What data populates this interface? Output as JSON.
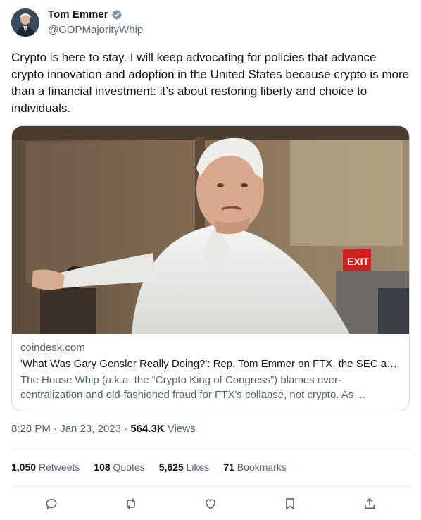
{
  "author": {
    "name": "Tom Emmer",
    "handle": "@GOPMajorityWhip",
    "verified_icon": "verified-badge-icon"
  },
  "tweet": {
    "text": "Crypto is here to stay. I will keep advocating for policies that advance crypto innovation and adoption in the United States because crypto is more than a financial investment: it’s about restoring liberty and choice to individuals."
  },
  "card": {
    "domain": "coindesk.com",
    "title": "'What Was Gary Gensler Really Doing?': Rep. Tom Emmer on FTX, the SEC and...",
    "description": "The House Whip (a.k.a. the “Crypto King of Congress”) blames over-centralization and old-fashioned fraud for FTX’s collapse, not crypto. As ..."
  },
  "meta": {
    "time": "8:28 PM",
    "separator1": "·",
    "date": "Jan 23, 2023",
    "separator2": "·",
    "views_count": "564.3K",
    "views_label": "Views"
  },
  "stats": {
    "retweets_count": "1,050",
    "retweets_label": "Retweets",
    "quotes_count": "108",
    "quotes_label": "Quotes",
    "likes_count": "5,625",
    "likes_label": "Likes",
    "bookmarks_count": "71",
    "bookmarks_label": "Bookmarks"
  },
  "actions": {
    "reply": "reply-icon",
    "retweet": "retweet-icon",
    "like": "heart-icon",
    "bookmark": "bookmark-icon",
    "share": "share-icon"
  },
  "colors": {
    "text_primary": "#0f1419",
    "text_secondary": "#536471",
    "verified": "#829aab",
    "border": "#cfd9de"
  }
}
